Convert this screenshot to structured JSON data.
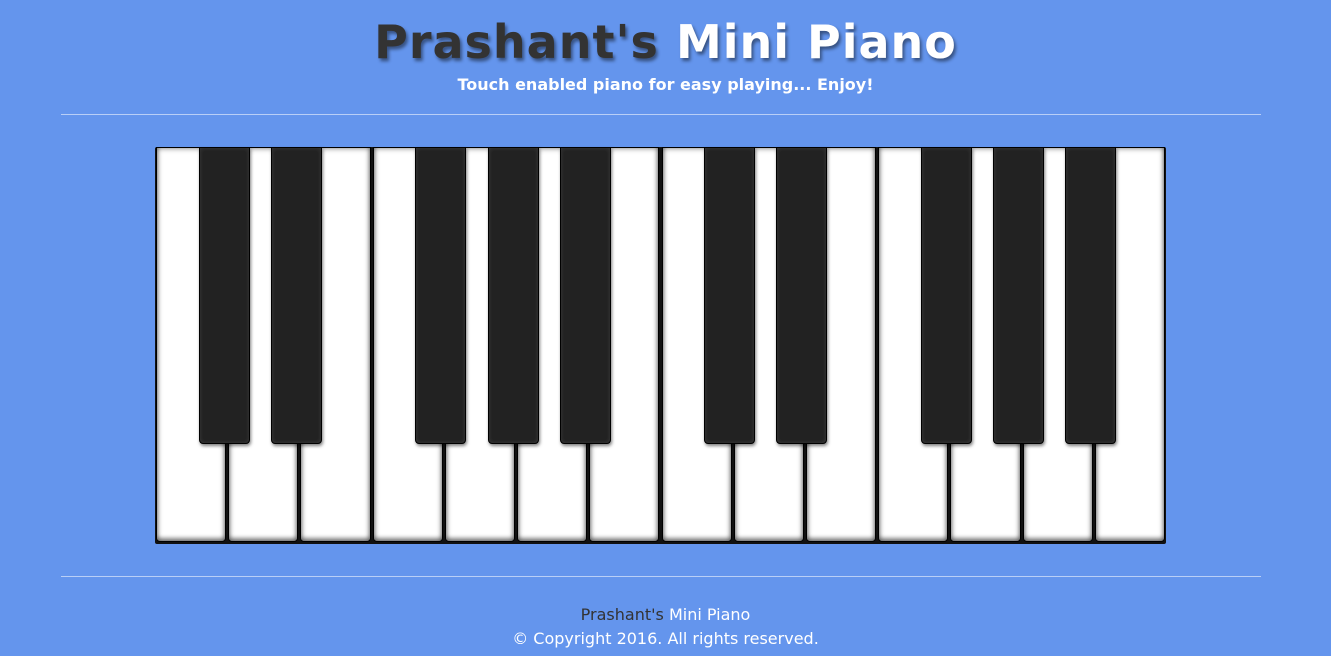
{
  "header": {
    "title_owner": "Prashant's",
    "title_app": "Mini Piano",
    "subtitle": "Touch enabled piano for easy playing... Enjoy!"
  },
  "piano": {
    "white_key_count": 14,
    "black_key_count": 10
  },
  "footer": {
    "brand_owner": "Prashant's",
    "brand_app": "Mini Piano",
    "copyright": "© Copyright 2016. All rights reserved."
  },
  "colors": {
    "background": "#6495ED",
    "white_key": "#ffffff",
    "black_key": "#222222",
    "title_owner": "#333333",
    "title_app": "#ffffff"
  }
}
